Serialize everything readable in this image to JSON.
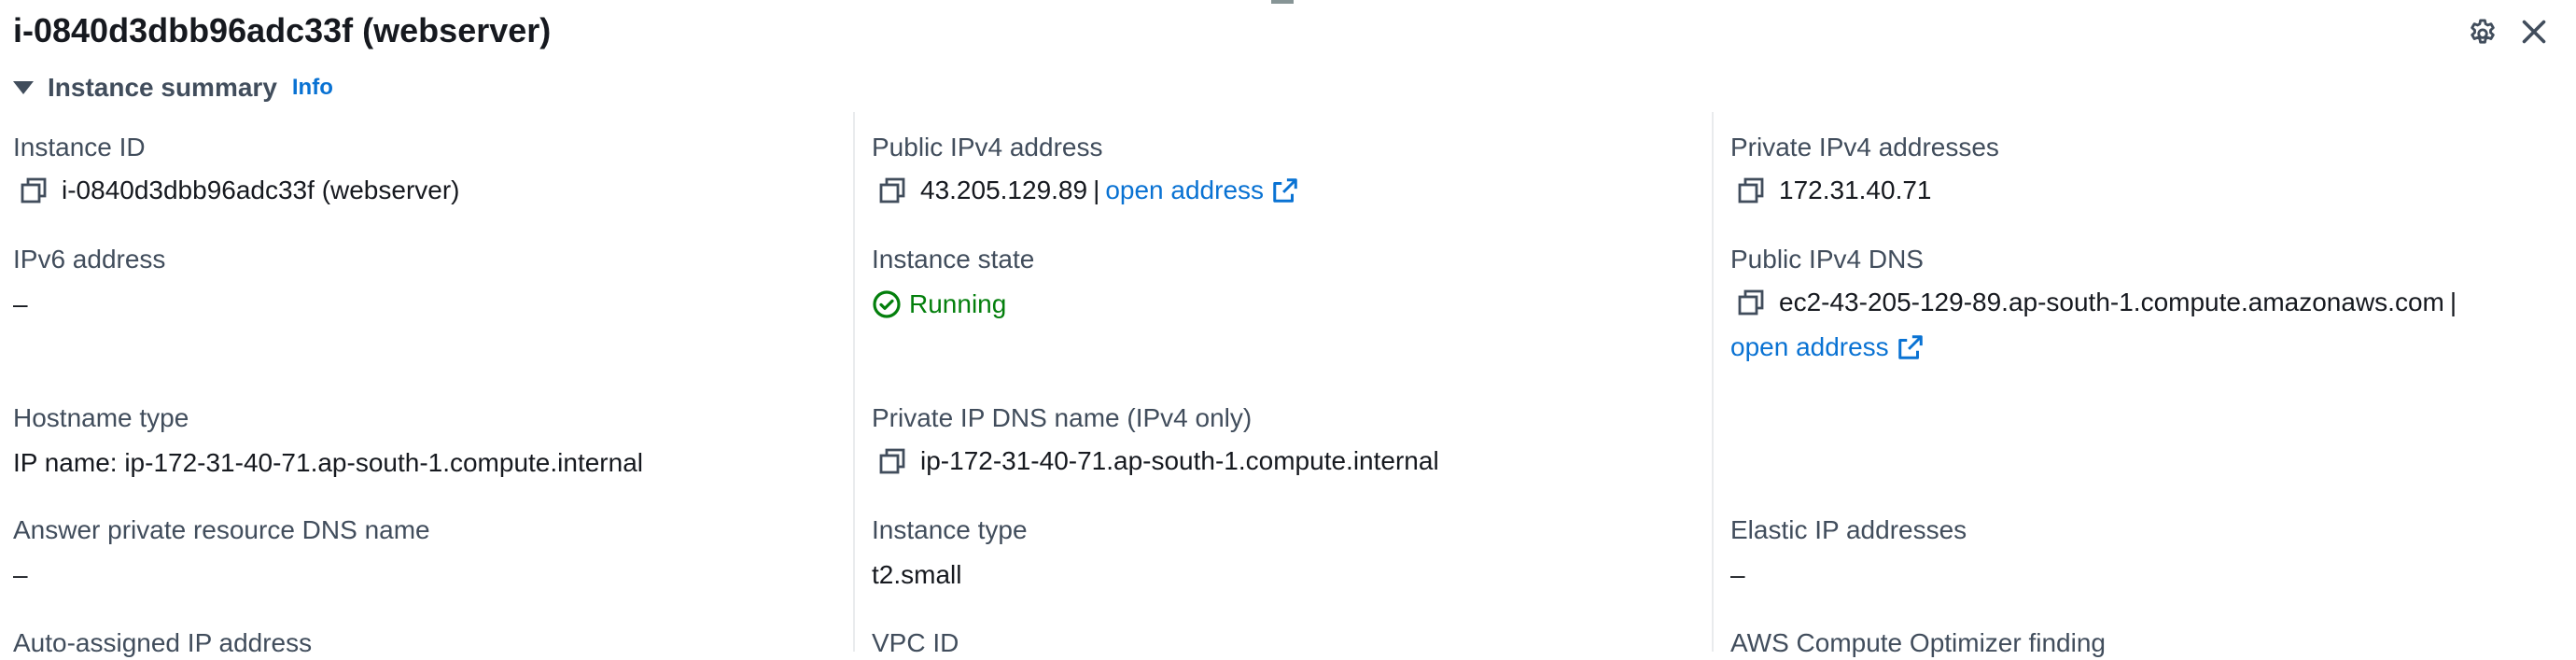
{
  "header": {
    "title": "i-0840d3dbb96adc33f (webserver)"
  },
  "section": {
    "title": "Instance summary",
    "info_label": "Info"
  },
  "fields": {
    "instance_id": {
      "label": "Instance ID",
      "value": "i-0840d3dbb96adc33f (webserver)"
    },
    "public_ipv4": {
      "label": "Public IPv4 address",
      "value": "43.205.129.89",
      "separator": "|",
      "link": "open address"
    },
    "private_ipv4": {
      "label": "Private IPv4 addresses",
      "value": "172.31.40.71"
    },
    "ipv6": {
      "label": "IPv6 address",
      "value": "–"
    },
    "instance_state": {
      "label": "Instance state",
      "value": "Running"
    },
    "public_dns": {
      "label": "Public IPv4 DNS",
      "value": "ec2-43-205-129-89.ap-south-1.compute.amazonaws.com",
      "separator": "|",
      "link": "open address"
    },
    "hostname_type": {
      "label": "Hostname type",
      "value": "IP name: ip-172-31-40-71.ap-south-1.compute.internal"
    },
    "private_dns": {
      "label": "Private IP DNS name (IPv4 only)",
      "value": "ip-172-31-40-71.ap-south-1.compute.internal"
    },
    "answer_dns": {
      "label": "Answer private resource DNS name",
      "value": "–"
    },
    "instance_type": {
      "label": "Instance type",
      "value": "t2.small"
    },
    "elastic_ip": {
      "label": "Elastic IP addresses",
      "value": "–"
    },
    "auto_ip": {
      "label": "Auto-assigned IP address"
    },
    "vpc_id": {
      "label": "VPC ID"
    },
    "optimizer": {
      "label": "AWS Compute Optimizer finding"
    }
  },
  "icons": {
    "settings": "gear-icon",
    "close": "close-icon",
    "copy": "copy-icon",
    "external": "external-link-icon",
    "status": "check-circle-icon"
  },
  "colors": {
    "link": "#0972d3",
    "success": "#037f0c",
    "label": "#414d5c",
    "text": "#16191f"
  }
}
